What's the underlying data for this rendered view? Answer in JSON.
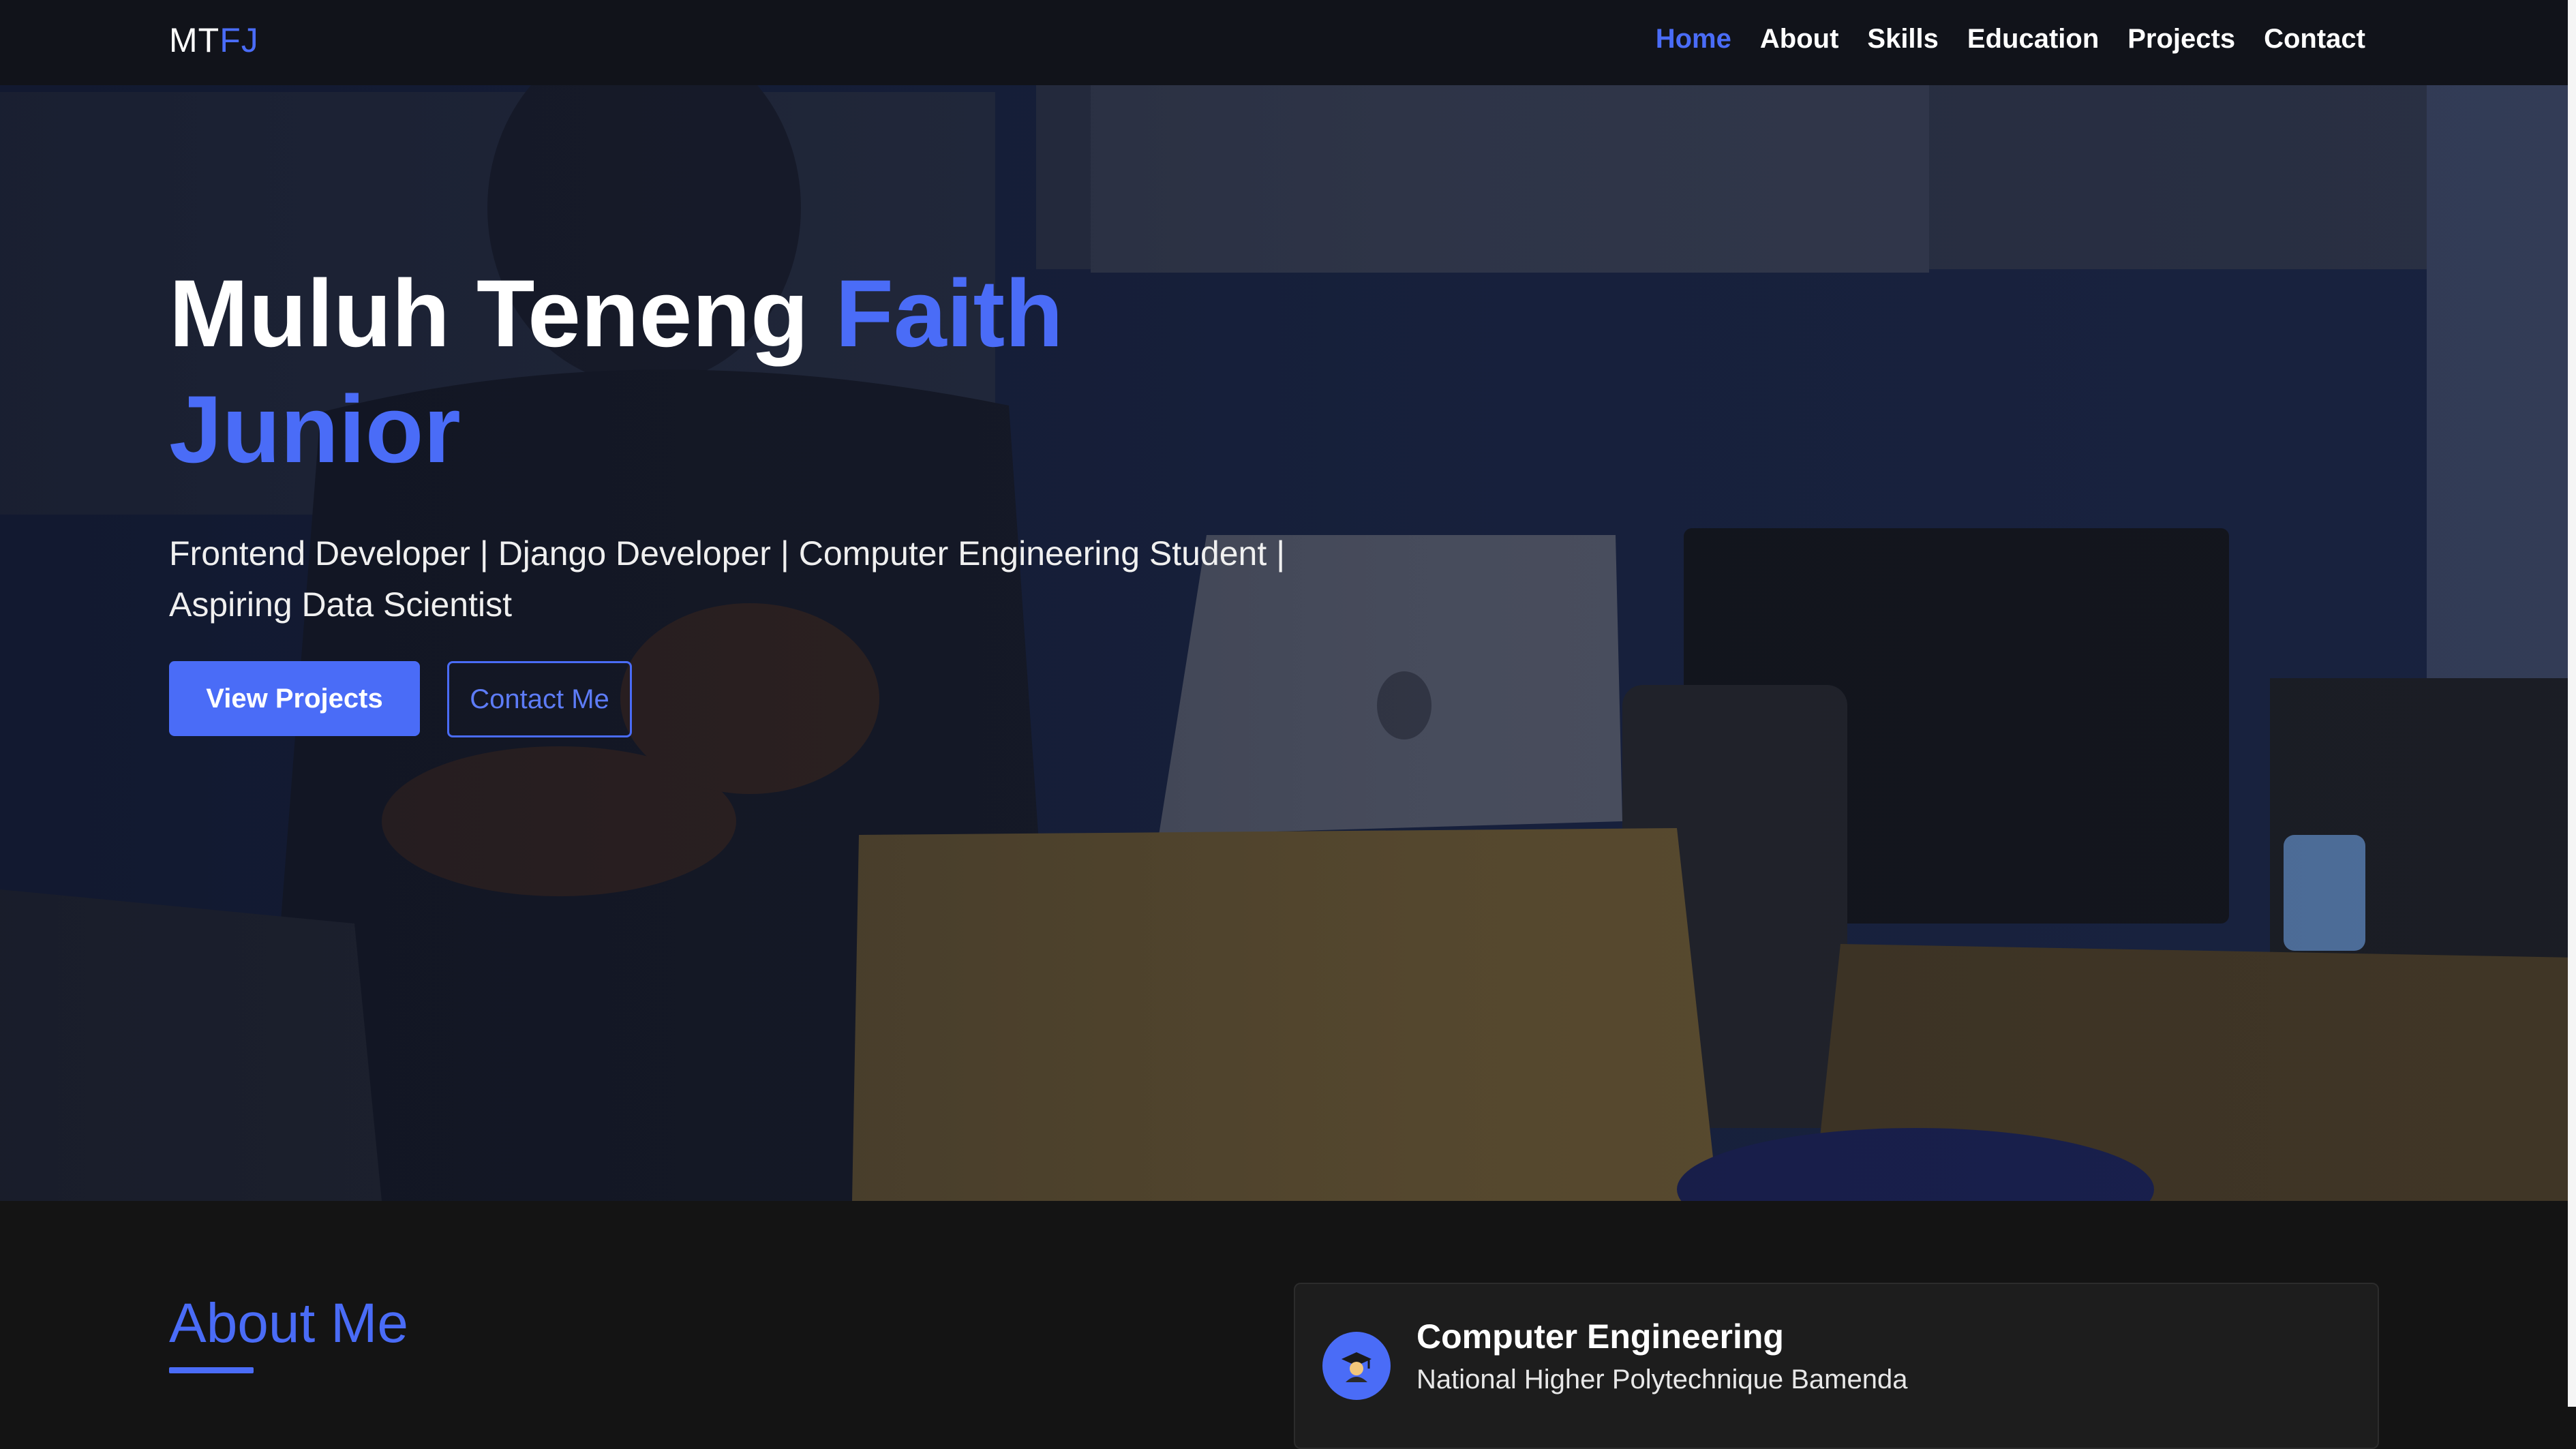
{
  "nav": {
    "brand_initials": "MT",
    "brand_accent": "FJ",
    "links": [
      {
        "label": "Home",
        "active": true
      },
      {
        "label": "About",
        "active": false
      },
      {
        "label": "Skills",
        "active": false
      },
      {
        "label": "Education",
        "active": false
      },
      {
        "label": "Projects",
        "active": false
      },
      {
        "label": "Contact",
        "active": false
      }
    ]
  },
  "hero": {
    "name_first": "Muluh Teneng",
    "name_accent": "Faith Junior",
    "subtitle": "Frontend Developer | Django Developer | Computer Engineering Student | Aspiring Data Scientist",
    "primary_button": "View Projects",
    "secondary_button": "Contact Me"
  },
  "about": {
    "title": "About Me",
    "education_card": {
      "degree": "Computer Engineering",
      "school": "National Higher Polytechnique Bamenda",
      "icon": "graduate-icon"
    }
  },
  "colors": {
    "accent": "#4a6cf7",
    "nav_bg": "#11131a",
    "page_bg": "#141414",
    "card_bg": "#1d1d1d"
  }
}
